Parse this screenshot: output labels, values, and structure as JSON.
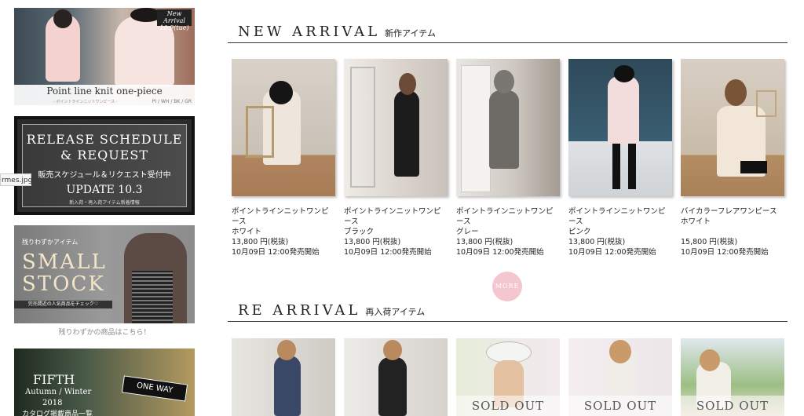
{
  "sidebar": {
    "banner1": {
      "tag": "New Arrival 10.9(tue)",
      "title": "Point line knit one-piece",
      "colors": "PI / WH / BK / GR",
      "sub": "- ポイントラインニットワンピース -"
    },
    "banner2": {
      "line1": "RELEASE SCHEDULE",
      "line2": "& REQUEST",
      "line3": "販売スケジュール＆リクエスト受付中",
      "line4": "UPDATE 10.3",
      "line5": "新入荷・再入荷アイテム新着情報"
    },
    "tooltip": "rmes.jpg",
    "banner3": {
      "small": "残りわずかアイテム",
      "big1": "SMALL",
      "big2": "STOCK",
      "bar": "完売間近の人気商品をチェック♡",
      "caption": "残りわずかの商品はこちら！"
    },
    "banner4": {
      "title": "FIFTH",
      "season": "Autumn / Winter",
      "year": "2018",
      "caption": "カタログ掲載商品一覧",
      "sign": "ONE WAY"
    }
  },
  "new_arrival": {
    "title_en": "NEW ARRIVAL",
    "title_jp": "新作アイテム",
    "more_label": "MORE",
    "products": [
      {
        "name": "ポイントラインニットワンピース",
        "color": "ホワイト",
        "price": "13,800 円(税抜)",
        "date": "10月09日 12:00発売開始"
      },
      {
        "name": "ポイントラインニットワンピース",
        "color": "ブラック",
        "price": "13,800 円(税抜)",
        "date": "10月09日 12:00発売開始"
      },
      {
        "name": "ポイントラインニットワンピース",
        "color": "グレー",
        "price": "13,800 円(税抜)",
        "date": "10月09日 12:00発売開始"
      },
      {
        "name": " ポイントラインニットワンピース",
        "color": "ピンク",
        "price": "13,800 円(税抜)",
        "date": "10月09日 12:00発売開始"
      },
      {
        "name": "バイカラーフレアワンピース",
        "color": "ホワイト",
        "price": "15,800 円(税抜)",
        "date": "10月09日 12:00発売開始"
      }
    ]
  },
  "re_arrival": {
    "title_en": "RE ARRIVAL",
    "title_jp": "再入荷アイテム",
    "sold_out_label": "SOLD OUT"
  }
}
